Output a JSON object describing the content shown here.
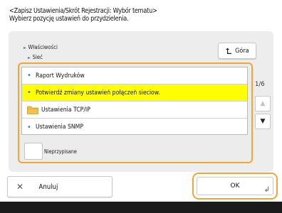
{
  "header": {
    "line1": "<Zapisz Ustawienia/Skrót Rejestracji: Wybór tematu>",
    "line2": "Wybierz pozycję ustawień do przydzielenia."
  },
  "breadcrumb": {
    "level1": "Właściwości",
    "level2": "Sieć"
  },
  "up_button": {
    "label": "Góra",
    "icon": "up-arrow-icon"
  },
  "list": {
    "items": [
      {
        "label": "Raport Wydruków",
        "type": "item",
        "selected": false
      },
      {
        "label": "Potwierdź zmiany ustawień połączeń sieciow.",
        "type": "item",
        "selected": true
      },
      {
        "label": "Ustawienia TCP/IP",
        "type": "folder",
        "selected": false
      },
      {
        "label": "Ustawienia SNMP",
        "type": "item",
        "selected": false
      }
    ]
  },
  "unassigned": {
    "label": "Nieprzypisane"
  },
  "pagination": {
    "indicator": "1/6"
  },
  "footer": {
    "cancel_label": "Anuluj",
    "ok_label": "OK"
  },
  "colors": {
    "highlight": "#ffff00",
    "focus_border": "#f0a830",
    "accent_blue": "#3a7ad6"
  }
}
